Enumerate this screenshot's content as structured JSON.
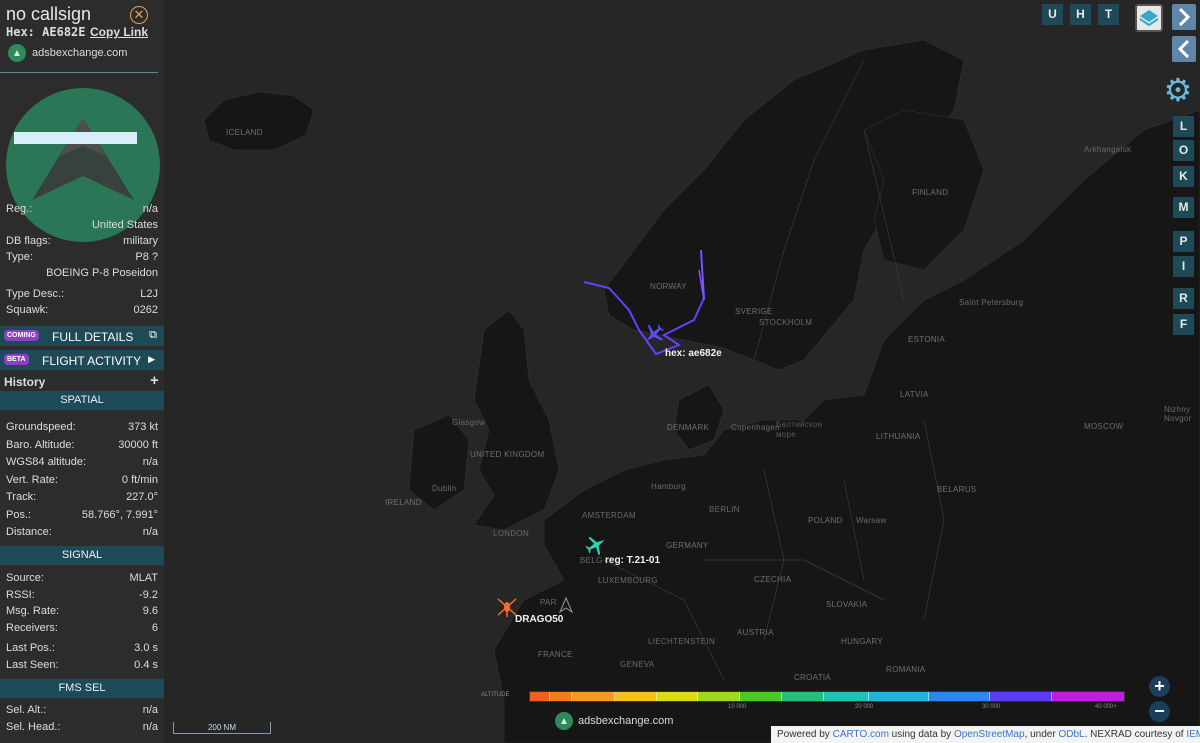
{
  "sidebar": {
    "callsign": "no callsign",
    "hex_label": "Hex:",
    "hex_value": "AE682E",
    "copy_link": "Copy Link",
    "site": "adsbexchange.com",
    "info": {
      "reg_label": "Reg.:",
      "reg_value": "n/a",
      "country": "United States",
      "dbflags_label": "DB flags:",
      "dbflags_value": "military",
      "type_label": "Type:",
      "type_value": "P8 ?",
      "type_full": "BOEING P-8 Poseidon",
      "typedesc_label": "Type Desc.:",
      "typedesc_value": "L2J",
      "squawk_label": "Squawk:",
      "squawk_value": "0262"
    },
    "full_details": {
      "badge": "COMING",
      "label": "FULL DETAILS"
    },
    "flight_activity": {
      "badge": "BETA",
      "label": "FLIGHT ACTIVITY"
    },
    "history_label": "History",
    "spatial": {
      "header": "SPATIAL",
      "rows": [
        {
          "k": "Groundspeed:",
          "v": "373 kt"
        },
        {
          "k": "Baro. Altitude:",
          "v": "30000 ft"
        },
        {
          "k": "WGS84 altitude:",
          "v": "n/a"
        },
        {
          "k": "Vert. Rate:",
          "v": "0 ft/min"
        },
        {
          "k": "Track:",
          "v": "227.0°"
        },
        {
          "k": "Pos.:",
          "v": "58.766°, 7.991°"
        },
        {
          "k": "Distance:",
          "v": "n/a"
        }
      ]
    },
    "signal": {
      "header": "SIGNAL",
      "rows": [
        {
          "k": "Source:",
          "v": "MLAT"
        },
        {
          "k": "RSSI:",
          "v": "-9.2"
        },
        {
          "k": "Msg. Rate:",
          "v": "9.6"
        },
        {
          "k": "Receivers:",
          "v": "6"
        },
        {
          "k": "Last Pos.:",
          "v": "3.0 s"
        },
        {
          "k": "Last Seen:",
          "v": "0.4 s"
        }
      ]
    },
    "fms": {
      "header": "FMS SEL",
      "rows": [
        {
          "k": "Sel. Alt.:",
          "v": "n/a"
        },
        {
          "k": "Sel. Head.:",
          "v": "n/a"
        }
      ]
    }
  },
  "map": {
    "labels": {
      "iceland": "ICELAND",
      "norway": "NORWAY",
      "sweden": "SVERIGE",
      "finland": "FINLAND",
      "denmark": "DENMARK",
      "uk": "UNITED KINGDOM",
      "ireland": "IRELAND",
      "germany": "GERMANY",
      "poland": "POLAND",
      "france": "FRANCE",
      "belarus": "BELARUS",
      "lithuania": "LITHUANIA",
      "latvia": "LATVIA",
      "estonia": "ESTONIA",
      "czechia": "CZECHIA",
      "austria": "AUSTRIA",
      "hungary": "HUNGARY",
      "slovakia": "SLOVAKIA",
      "romania": "ROMANIA",
      "luxembourg": "LUXEMBOURG",
      "liechtenstein": "LIECHTENSTEIN",
      "croatia": "CROATIA",
      "stockholm": "STOCKHOLM",
      "moscow": "MOSCOW",
      "warsaw": "Warsaw",
      "berlin": "BERLIN",
      "amsterdam": "AMSTERDAM",
      "london": "LONDON",
      "dublin": "Dublin",
      "hamburg": "Hamburg",
      "copenhagen": "Copenhagen",
      "arkhangelsk": "Arkhangelsk",
      "saint_petersburg": "Saint Petersburg",
      "nizhny": "Nizhny Novgor",
      "geneva": "GENEVA",
      "baltic": "Балтийское море",
      "belgium": "BELG",
      "paris": "PAR",
      "glasgow": "Glasgow"
    },
    "aircraft": [
      {
        "label": "hex: ae682e",
        "color": "#5c4dff"
      },
      {
        "label": "reg: T.21-01",
        "color": "#2fd3b0"
      },
      {
        "label": "DRAGO50",
        "color": "#ff6a28"
      }
    ],
    "toolbar": {
      "u": "U",
      "h": "H",
      "t": "T"
    },
    "right_buttons": [
      "L",
      "O",
      "K",
      "M",
      "P",
      "I",
      "R",
      "F"
    ],
    "zoom": {
      "in": "+",
      "out": "−"
    },
    "scale": "200 NM",
    "altitude": {
      "title": "ALTITUDE",
      "ticks": [
        "10 000",
        "20 000",
        "30 000",
        "40 000+"
      ]
    },
    "footer_site": "adsbexchange.com",
    "attribution": {
      "prefix": "Powered by ",
      "carto": "CARTO.com",
      "mid": " using data by ",
      "osm": "OpenStreetMap",
      "under": ", under ",
      "odbl": "ODbL",
      "nexrad": ". NEXRAD courtesy of ",
      "iem": "IEM"
    }
  }
}
